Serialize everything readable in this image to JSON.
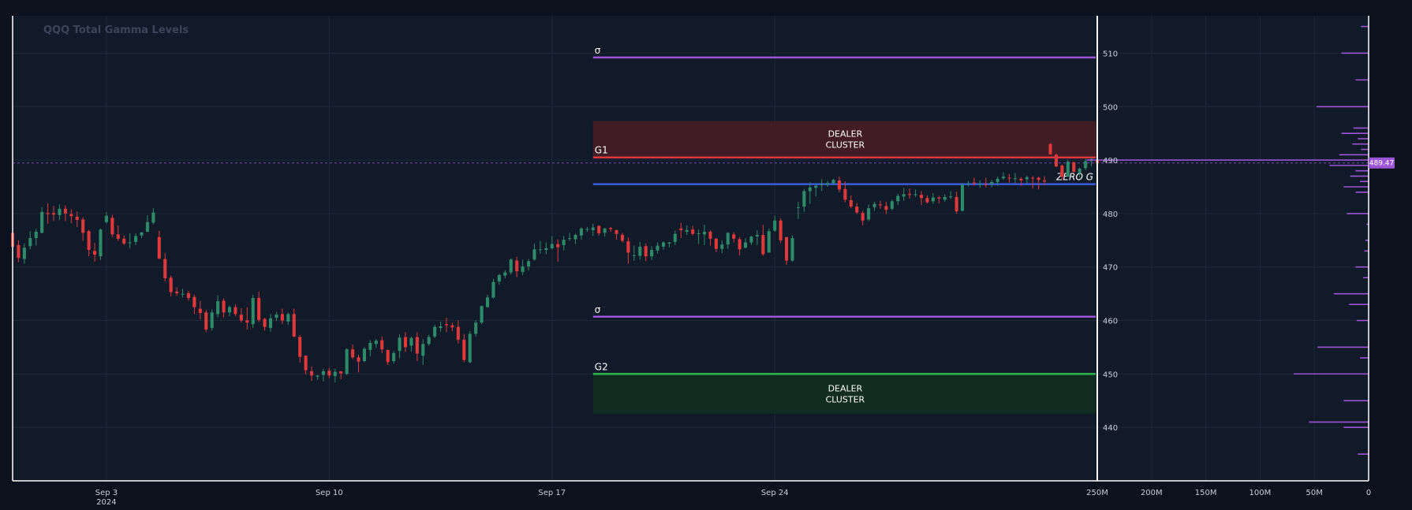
{
  "chart_data": {
    "type": "candlestick",
    "title": "QQQ Total Gamma Levels",
    "symbol": "QQQ",
    "ylim": [
      430,
      517
    ],
    "yticks": [
      "510",
      "500",
      "490",
      "480",
      "470",
      "460",
      "450",
      "440"
    ],
    "ytick_values": [
      510,
      500,
      490,
      480,
      470,
      460,
      450,
      440
    ],
    "x_tick_labels": [
      {
        "label": "Sep 3",
        "sub": "2024",
        "bar": 16
      },
      {
        "label": "Sep 10",
        "sub": "",
        "bar": 54
      },
      {
        "label": "Sep 17",
        "sub": "",
        "bar": 92
      },
      {
        "label": "Sep 24",
        "sub": "",
        "bar": 130
      }
    ],
    "last_price": "489.47",
    "last_price_value": 489.47,
    "levels": [
      {
        "label": "σ",
        "value": 509.2,
        "color": "#9b55d6",
        "start_bar": 99
      },
      {
        "label": "G1",
        "value": 490.5,
        "color": "#d9383c",
        "start_bar": 99
      },
      {
        "label": "ZERO G",
        "value": 485.5,
        "color": "#3b5bdb",
        "start_bar": 99
      },
      {
        "label": "σ",
        "value": 460.7,
        "color": "#9b55d6",
        "start_bar": 99
      },
      {
        "label": "G2",
        "value": 450.0,
        "color": "#2db84b",
        "start_bar": 99
      }
    ],
    "clusters": [
      {
        "lines": [
          "DEALER",
          "CLUSTER"
        ],
        "top": 497.3,
        "bottom": 490.5,
        "color": "#4a1d24",
        "start_bar": 99
      },
      {
        "lines": [
          "DEALER",
          "CLUSTER"
        ],
        "top": 450.0,
        "bottom": 442.6,
        "color": "#12301f",
        "start_bar": 99
      }
    ],
    "colors": {
      "up": "#2e8b6a",
      "down": "#e0393c",
      "background": "#111a29",
      "grid": "#1d2838",
      "axis": "#ffffff",
      "profile": "#9b55d6"
    },
    "candles": [
      [
        476.4,
        477.2,
        472.4,
        473.8
      ],
      [
        474.1,
        475.0,
        470.9,
        471.7
      ],
      [
        471.5,
        474.4,
        470.6,
        473.6
      ],
      [
        473.9,
        476.7,
        473.3,
        475.4
      ],
      [
        475.4,
        477.1,
        474.0,
        476.6
      ],
      [
        476.4,
        481.2,
        476.3,
        480.3
      ],
      [
        480.1,
        481.9,
        478.1,
        479.9
      ],
      [
        480.1,
        481.4,
        478.6,
        479.8
      ],
      [
        479.7,
        481.7,
        478.8,
        480.9
      ],
      [
        480.9,
        481.5,
        478.6,
        480.0
      ],
      [
        479.9,
        480.8,
        478.2,
        479.5
      ],
      [
        479.4,
        480.4,
        477.5,
        478.8
      ],
      [
        478.9,
        479.3,
        474.9,
        476.4
      ],
      [
        476.7,
        477.0,
        472.0,
        473.2
      ],
      [
        473.0,
        474.5,
        471.0,
        472.3
      ],
      [
        472.0,
        477.2,
        471.3,
        477.0
      ],
      [
        478.4,
        480.3,
        478.1,
        479.6
      ],
      [
        479.2,
        479.8,
        475.6,
        476.1
      ],
      [
        476.1,
        477.8,
        474.9,
        475.3
      ],
      [
        475.3,
        475.9,
        474.1,
        474.4
      ],
      [
        474.5,
        476.3,
        473.5,
        474.6
      ],
      [
        474.7,
        476.3,
        474.1,
        475.8
      ],
      [
        475.9,
        476.5,
        475.4,
        476.5
      ],
      [
        476.6,
        479.7,
        476.5,
        478.4
      ],
      [
        478.3,
        481.0,
        478.0,
        480.2
      ],
      [
        475.6,
        476.8,
        471.4,
        471.6
      ],
      [
        471.5,
        472.6,
        467.3,
        467.9
      ],
      [
        468.0,
        468.4,
        464.5,
        465.3
      ],
      [
        465.4,
        466.2,
        464.6,
        465.1
      ],
      [
        465.0,
        465.9,
        464.3,
        465.0
      ],
      [
        465.1,
        465.5,
        463.7,
        464.2
      ],
      [
        464.4,
        464.8,
        461.2,
        462.5
      ],
      [
        462.2,
        463.7,
        460.2,
        461.4
      ],
      [
        461.5,
        461.9,
        457.8,
        458.3
      ],
      [
        458.6,
        462.1,
        458.1,
        461.5
      ],
      [
        461.2,
        464.7,
        460.6,
        463.6
      ],
      [
        463.7,
        464.1,
        460.6,
        461.5
      ],
      [
        461.5,
        462.8,
        460.8,
        462.5
      ],
      [
        462.5,
        463.0,
        460.8,
        461.2
      ],
      [
        461.1,
        462.3,
        459.6,
        460.0
      ],
      [
        460.0,
        462.5,
        458.3,
        459.6
      ],
      [
        459.3,
        464.8,
        458.6,
        464.2
      ],
      [
        464.2,
        465.4,
        459.7,
        460.1
      ],
      [
        460.3,
        460.5,
        458.1,
        458.8
      ],
      [
        458.6,
        461.2,
        457.9,
        460.4
      ],
      [
        460.5,
        461.6,
        459.9,
        461.1
      ],
      [
        461.2,
        462.2,
        459.3,
        460.0
      ],
      [
        459.8,
        461.5,
        459.2,
        461.2
      ],
      [
        461.2,
        462.2,
        456.8,
        457.0
      ],
      [
        456.9,
        457.3,
        452.1,
        453.2
      ],
      [
        453.4,
        453.5,
        449.9,
        450.7
      ],
      [
        450.5,
        451.4,
        448.7,
        449.7
      ],
      [
        449.5,
        449.8,
        448.9,
        449.7
      ],
      [
        449.8,
        451.0,
        448.6,
        450.5
      ],
      [
        450.6,
        451.1,
        449.2,
        449.7
      ],
      [
        449.6,
        451.0,
        448.4,
        450.4
      ],
      [
        450.5,
        450.5,
        449.0,
        450.1
      ],
      [
        450.0,
        454.8,
        449.8,
        454.6
      ],
      [
        454.6,
        455.5,
        452.8,
        453.1
      ],
      [
        453.1,
        453.6,
        450.3,
        452.3
      ],
      [
        452.4,
        455.0,
        452.2,
        454.7
      ],
      [
        454.5,
        456.3,
        453.3,
        455.8
      ],
      [
        455.6,
        456.5,
        454.9,
        456.2
      ],
      [
        456.3,
        457.0,
        453.9,
        454.6
      ],
      [
        454.5,
        454.5,
        451.7,
        452.2
      ],
      [
        452.4,
        454.3,
        451.9,
        453.9
      ],
      [
        454.3,
        457.4,
        452.9,
        456.8
      ],
      [
        456.9,
        457.8,
        454.1,
        455.0
      ],
      [
        455.3,
        457.0,
        454.2,
        456.7
      ],
      [
        456.9,
        457.8,
        452.4,
        453.8
      ],
      [
        453.4,
        456.5,
        451.7,
        455.6
      ],
      [
        455.6,
        457.3,
        455.3,
        456.9
      ],
      [
        457.0,
        459.2,
        456.7,
        458.8
      ],
      [
        458.6,
        459.8,
        457.9,
        458.9
      ],
      [
        459.3,
        460.5,
        457.8,
        459.1
      ],
      [
        459.1,
        459.6,
        458.0,
        458.7
      ],
      [
        458.8,
        460.0,
        455.7,
        456.4
      ],
      [
        456.4,
        457.5,
        452.2,
        452.6
      ],
      [
        452.2,
        458.0,
        452.0,
        457.5
      ],
      [
        457.5,
        460.1,
        457.0,
        459.6
      ],
      [
        459.6,
        462.8,
        459.3,
        462.7
      ],
      [
        462.5,
        464.8,
        462.4,
        464.3
      ],
      [
        464.3,
        467.8,
        464.1,
        467.2
      ],
      [
        467.3,
        468.7,
        466.7,
        468.5
      ],
      [
        468.4,
        469.4,
        467.9,
        469.0
      ],
      [
        469.0,
        471.6,
        468.6,
        471.4
      ],
      [
        471.2,
        471.9,
        468.1,
        469.2
      ],
      [
        469.1,
        471.4,
        468.5,
        470.1
      ],
      [
        470.1,
        471.5,
        469.4,
        471.1
      ],
      [
        471.4,
        474.4,
        471.2,
        473.3
      ],
      [
        473.2,
        474.9,
        472.5,
        473.3
      ],
      [
        473.2,
        474.6,
        472.4,
        473.5
      ],
      [
        473.5,
        475.8,
        473.3,
        474.3
      ],
      [
        474.3,
        475.2,
        471.0,
        473.7
      ],
      [
        474.1,
        475.8,
        473.1,
        475.1
      ],
      [
        475.3,
        476.4,
        474.9,
        475.4
      ],
      [
        475.2,
        476.2,
        474.3,
        476.0
      ],
      [
        475.9,
        477.4,
        475.1,
        477.2
      ],
      [
        477.0,
        477.5,
        476.6,
        477.1
      ],
      [
        476.9,
        478.1,
        475.8,
        477.4
      ],
      [
        477.7,
        477.8,
        475.9,
        476.3
      ],
      [
        476.4,
        477.3,
        475.7,
        477.2
      ],
      [
        477.3,
        477.5,
        476.6,
        477.1
      ],
      [
        476.9,
        477.0,
        475.1,
        476.2
      ],
      [
        476.0,
        476.4,
        474.6,
        474.9
      ],
      [
        474.8,
        475.5,
        470.6,
        472.7
      ],
      [
        472.1,
        474.0,
        471.2,
        472.2
      ],
      [
        472.1,
        474.7,
        471.4,
        473.8
      ],
      [
        473.9,
        474.4,
        471.1,
        472.0
      ],
      [
        472.0,
        473.9,
        471.3,
        473.2
      ],
      [
        473.1,
        474.6,
        472.5,
        474.0
      ],
      [
        473.8,
        474.8,
        473.2,
        474.6
      ],
      [
        474.4,
        474.7,
        473.7,
        474.6
      ],
      [
        474.7,
        476.8,
        474.1,
        476.2
      ],
      [
        477.2,
        478.3,
        475.4,
        476.9
      ],
      [
        476.6,
        477.8,
        476.0,
        476.9
      ],
      [
        477.0,
        477.7,
        475.9,
        476.2
      ],
      [
        476.2,
        477.0,
        474.3,
        476.3
      ],
      [
        476.1,
        477.9,
        474.1,
        476.6
      ],
      [
        476.6,
        476.9,
        474.0,
        475.3
      ],
      [
        475.3,
        475.4,
        472.8,
        473.4
      ],
      [
        473.4,
        475.0,
        472.6,
        474.2
      ],
      [
        474.2,
        476.5,
        473.4,
        476.4
      ],
      [
        476.1,
        476.5,
        474.6,
        475.3
      ],
      [
        475.2,
        475.6,
        472.2,
        473.3
      ],
      [
        473.6,
        475.4,
        473.5,
        474.6
      ],
      [
        474.6,
        475.8,
        474.1,
        475.7
      ],
      [
        475.7,
        476.9,
        474.1,
        476.0
      ],
      [
        476.0,
        477.9,
        472.1,
        472.4
      ],
      [
        472.7,
        477.2,
        472.7,
        476.7
      ],
      [
        476.8,
        479.6,
        476.6,
        478.7
      ],
      [
        478.7,
        479.1,
        474.5,
        475.0
      ],
      [
        475.6,
        475.6,
        470.4,
        471.2
      ],
      [
        471.2,
        475.9,
        471.0,
        475.4
      ],
      [
        481.1,
        482.2,
        479.0,
        481.2
      ],
      [
        481.3,
        484.6,
        480.3,
        484.2
      ],
      [
        484.2,
        485.9,
        481.8,
        484.9
      ],
      [
        484.8,
        485.6,
        483.2,
        485.2
      ],
      [
        485.3,
        486.4,
        484.2,
        485.5
      ],
      [
        485.4,
        486.1,
        485.0,
        485.7
      ],
      [
        485.7,
        486.5,
        485.3,
        486.3
      ],
      [
        486.2,
        486.9,
        484.0,
        484.5
      ],
      [
        484.6,
        486.0,
        482.1,
        482.6
      ],
      [
        482.5,
        483.4,
        481.0,
        481.3
      ],
      [
        481.3,
        482.0,
        479.9,
        480.2
      ],
      [
        480.1,
        480.5,
        477.8,
        478.7
      ],
      [
        478.9,
        481.7,
        478.6,
        481.0
      ],
      [
        481.2,
        482.2,
        480.5,
        481.8
      ],
      [
        481.7,
        482.4,
        480.9,
        481.6
      ],
      [
        481.4,
        482.2,
        479.9,
        480.7
      ],
      [
        480.9,
        482.6,
        480.6,
        482.3
      ],
      [
        482.3,
        483.7,
        481.6,
        483.3
      ],
      [
        483.2,
        484.8,
        482.4,
        483.6
      ],
      [
        483.7,
        484.7,
        482.8,
        483.5
      ],
      [
        483.6,
        484.5,
        483.1,
        483.6
      ],
      [
        483.5,
        484.2,
        481.6,
        482.9
      ],
      [
        482.9,
        483.4,
        481.9,
        482.1
      ],
      [
        482.3,
        483.8,
        481.8,
        483.0
      ],
      [
        483.0,
        483.3,
        481.9,
        482.8
      ],
      [
        482.6,
        483.6,
        482.2,
        483.1
      ],
      [
        483.1,
        484.2,
        482.7,
        483.2
      ],
      [
        483.1,
        484.1,
        480.0,
        480.4
      ],
      [
        480.5,
        485.7,
        480.4,
        485.4
      ],
      [
        485.5,
        486.1,
        485.1,
        485.6
      ],
      [
        485.8,
        486.7,
        485.2,
        485.6
      ],
      [
        485.4,
        486.2,
        484.8,
        485.5
      ],
      [
        485.5,
        486.7,
        484.9,
        485.4
      ],
      [
        485.5,
        486.3,
        484.9,
        485.9
      ],
      [
        485.9,
        486.9,
        485.2,
        486.5
      ],
      [
        486.6,
        487.7,
        486.3,
        486.9
      ],
      [
        486.7,
        487.4,
        485.8,
        486.6
      ],
      [
        486.6,
        487.6,
        485.7,
        486.6
      ],
      [
        486.5,
        486.8,
        485.2,
        486.2
      ],
      [
        486.4,
        487.1,
        485.6,
        486.8
      ],
      [
        486.7,
        487.0,
        484.7,
        486.6
      ],
      [
        486.7,
        486.9,
        484.5,
        486.3
      ],
      [
        486.2,
        487.0,
        485.3,
        486.0
      ],
      [
        493.0,
        493.2,
        491.0,
        491.1
      ],
      [
        491.0,
        491.2,
        488.7,
        488.8
      ],
      [
        489.0,
        489.2,
        486.3,
        486.9
      ],
      [
        486.9,
        490.1,
        486.8,
        489.7
      ],
      [
        489.6,
        489.7,
        487.7,
        487.8
      ],
      [
        487.6,
        488.6,
        486.8,
        488.4
      ],
      [
        488.5,
        490.2,
        488.1,
        489.8
      ],
      [
        489.8,
        490.5,
        488.8,
        490.2
      ],
      [
        490.1,
        490.4,
        489.2,
        489.4
      ]
    ],
    "gamma_profile": {
      "strikes": [
        515,
        510,
        505,
        500,
        496,
        495,
        494,
        493,
        492,
        491,
        490,
        489,
        488,
        487,
        486,
        485,
        484,
        480,
        478,
        475,
        473,
        470,
        468,
        465,
        463,
        460,
        455,
        453,
        450,
        445,
        441,
        440,
        435
      ],
      "values": [
        7,
        25,
        12,
        48,
        14,
        25,
        10,
        15,
        7,
        27,
        260,
        36,
        12,
        17,
        8,
        23,
        12,
        20,
        2,
        3,
        4,
        12,
        5,
        32,
        18,
        11,
        47,
        8,
        69,
        23,
        55,
        23,
        10
      ],
      "xticks": [
        "250M",
        "200M",
        "150M",
        "100M",
        "50M",
        "0"
      ],
      "xtick_values": [
        250,
        200,
        150,
        100,
        50,
        0
      ]
    }
  }
}
